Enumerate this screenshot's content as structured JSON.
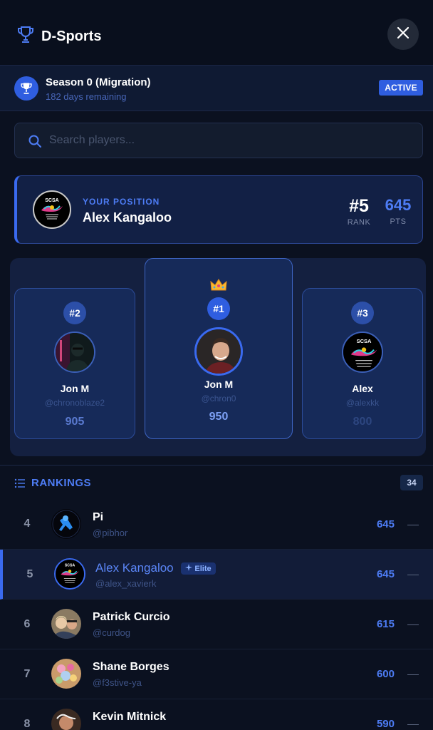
{
  "header": {
    "title": "D-Sports"
  },
  "season": {
    "name": "Season 0 (Migration)",
    "remaining": "182 days remaining",
    "status": "ACTIVE"
  },
  "search": {
    "placeholder": "Search players..."
  },
  "my_position": {
    "label": "YOUR POSITION",
    "name": "Alex Kangaloo",
    "rank": "#5",
    "rank_label": "RANK",
    "points": "645",
    "points_label": "PTS"
  },
  "podium": {
    "first": {
      "rank": "#1",
      "name": "Jon M",
      "handle": "@chron0",
      "points": "950"
    },
    "second": {
      "rank": "#2",
      "name": "Jon M",
      "handle": "@chronoblaze2",
      "points": "905"
    },
    "third": {
      "rank": "#3",
      "name": "Alex",
      "handle": "@alexkk",
      "points": "800"
    }
  },
  "rankings": {
    "title": "RANKINGS",
    "count": "34",
    "rows": [
      {
        "rank": "4",
        "name": "Pi",
        "handle": "@pibhor",
        "points": "645",
        "change": "—"
      },
      {
        "rank": "5",
        "name": "Alex Kangaloo",
        "handle": "@alex_xavierk",
        "points": "645",
        "change": "—",
        "badge": "Elite"
      },
      {
        "rank": "6",
        "name": "Patrick Curcio",
        "handle": "@curdog",
        "points": "615",
        "change": "—"
      },
      {
        "rank": "7",
        "name": "Shane Borges",
        "handle": "@f3stive-ya",
        "points": "600",
        "change": "—"
      },
      {
        "rank": "8",
        "name": "Kevin Mitnick",
        "handle": "",
        "points": "590",
        "change": "—"
      }
    ]
  },
  "logo_text": "SCSA",
  "colors": {
    "accent": "#3a6af0",
    "background": "#0b1120",
    "card": "#162a59"
  },
  "icons": {
    "brand": "trophy-icon",
    "close": "close-icon",
    "season": "trophy-icon",
    "search": "search-icon",
    "rankings": "list-icon",
    "crown": "crown-icon",
    "elite": "sparkle-icon"
  }
}
